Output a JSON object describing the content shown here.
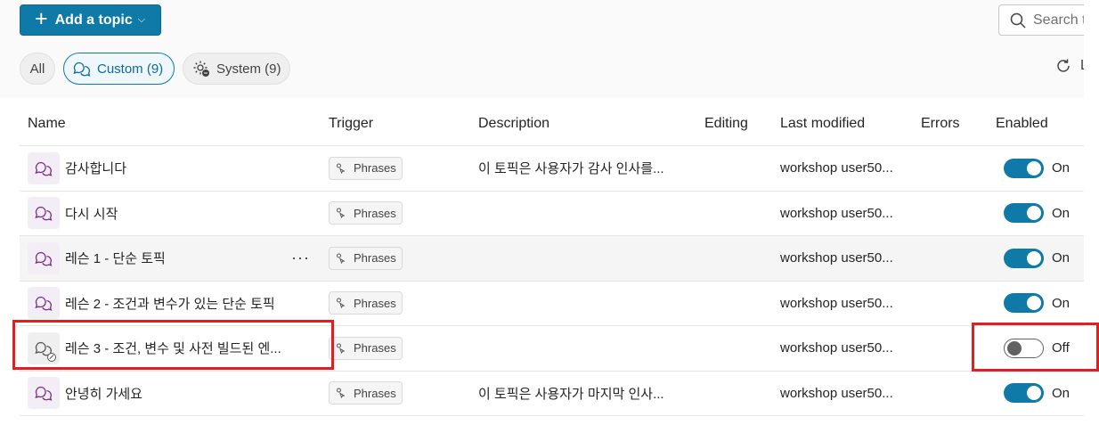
{
  "toolbar": {
    "add_topic_label": "Add a topic",
    "search_placeholder": "Search t",
    "refresh_label": "L"
  },
  "filters": {
    "all": "All",
    "custom": "Custom (9)",
    "system": "System (9)"
  },
  "table": {
    "headers": {
      "name": "Name",
      "trigger": "Trigger",
      "description": "Description",
      "editing": "Editing",
      "last_modified": "Last modified",
      "errors": "Errors",
      "enabled": "Enabled"
    },
    "rows": [
      {
        "name": "감사합니다",
        "trigger": "Phrases",
        "description": "이 토픽은 사용자가 감사 인사를...",
        "last_modified": "workshop user50...",
        "enabled": "On"
      },
      {
        "name": "다시 시작",
        "trigger": "Phrases",
        "description": "",
        "last_modified": "workshop user50...",
        "enabled": "On"
      },
      {
        "name": "레슨 1 - 단순 토픽",
        "trigger": "Phrases",
        "description": "",
        "last_modified": "workshop user50...",
        "enabled": "On",
        "more": "···"
      },
      {
        "name": "레슨 2 - 조건과 변수가 있는 단순 토픽",
        "trigger": "Phrases",
        "description": "",
        "last_modified": "workshop user50...",
        "enabled": "On"
      },
      {
        "name": "레슨 3 - 조건, 변수 및 사전 빌드된 엔...",
        "trigger": "Phrases",
        "description": "",
        "last_modified": "workshop user50...",
        "enabled": "Off"
      },
      {
        "name": "안녕히 가세요",
        "trigger": "Phrases",
        "description": "이 토픽은 사용자가 마지막 인사...",
        "last_modified": "workshop user50...",
        "enabled": "On"
      }
    ]
  },
  "colors": {
    "accent": "#0f7aa8",
    "highlight_box": "#e02020",
    "topic_icon": "#7a2c8a"
  },
  "icons": {
    "add": "plus-icon",
    "search": "search-icon",
    "refresh": "refresh-icon",
    "topic": "chat-bubbles-icon",
    "phrases": "phrases-icon",
    "system": "gear-chat-icon"
  }
}
